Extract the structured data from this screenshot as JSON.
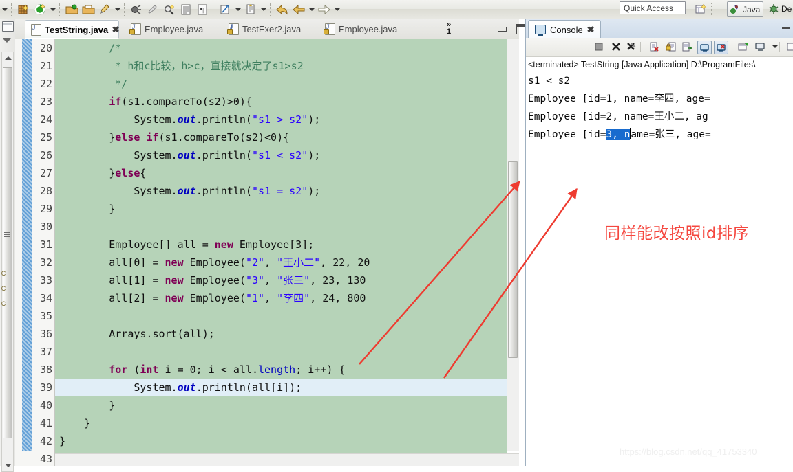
{
  "toolbar": {
    "quick_access_placeholder": "Quick Access",
    "perspective_java": "Java",
    "perspective_debug": "De",
    "icons": [
      "dropdown-arrow-icon",
      "new-wizard-icon",
      "run-icon",
      "run-dropdown-icon",
      "save-icon",
      "save-all-icon",
      "print-icon",
      "print-dropdown-icon",
      "debug-icon",
      "brush-icon",
      "search-icon",
      "outline-icon",
      "paragraph-icon",
      "external-tools-icon",
      "external-tools-dropdown-icon",
      "next-annotation-icon",
      "next-annotation-dropdown-icon",
      "back-icon",
      "back-yellow-icon",
      "back-dropdown-icon",
      "forward-icon",
      "forward-dropdown-icon"
    ]
  },
  "editor": {
    "tabs": [
      {
        "label": "TestString.java",
        "active": true,
        "closable": true,
        "locked": false
      },
      {
        "label": "Employee.java",
        "active": false,
        "closable": false,
        "locked": true
      },
      {
        "label": "TestExer2.java",
        "active": false,
        "closable": false,
        "locked": true
      },
      {
        "label": "Employee.java",
        "active": false,
        "closable": false,
        "locked": true
      }
    ],
    "overflow_chevron": "»",
    "overflow_count": "1",
    "minimize_label": "Minimize",
    "maximize_label": "Maximize",
    "first_line_number": 20,
    "highlighted_line": 39,
    "lines": [
      {
        "n": 20,
        "text": "        /*"
      },
      {
        "n": 21,
        "text": "         * h和c比较，h>c，直接就决定了s1>s2"
      },
      {
        "n": 22,
        "text": "         */"
      },
      {
        "n": 23,
        "text": "        if(s1.compareTo(s2)>0){"
      },
      {
        "n": 24,
        "text": "            System.out.println(\"s1 > s2\");"
      },
      {
        "n": 25,
        "text": "        }else if(s1.compareTo(s2)<0){"
      },
      {
        "n": 26,
        "text": "            System.out.println(\"s1 < s2\");"
      },
      {
        "n": 27,
        "text": "        }else{"
      },
      {
        "n": 28,
        "text": "            System.out.println(\"s1 = s2\");"
      },
      {
        "n": 29,
        "text": "        }"
      },
      {
        "n": 30,
        "text": ""
      },
      {
        "n": 31,
        "text": "        Employee[] all = new Employee[3];"
      },
      {
        "n": 32,
        "text": "        all[0] = new Employee(\"2\", \"王小二\", 22, 20"
      },
      {
        "n": 33,
        "text": "        all[1] = new Employee(\"3\", \"张三\", 23, 130"
      },
      {
        "n": 34,
        "text": "        all[2] = new Employee(\"1\", \"李四\", 24, 800"
      },
      {
        "n": 35,
        "text": ""
      },
      {
        "n": 36,
        "text": "        Arrays.sort(all);"
      },
      {
        "n": 37,
        "text": ""
      },
      {
        "n": 38,
        "text": "        for (int i = 0; i < all.length; i++) {"
      },
      {
        "n": 39,
        "text": "            System.out.println(all[i]);"
      },
      {
        "n": 40,
        "text": "        }"
      },
      {
        "n": 41,
        "text": "    }"
      },
      {
        "n": 42,
        "text": "}"
      },
      {
        "n": 43,
        "text": ""
      }
    ]
  },
  "console": {
    "tab_label": "Console",
    "tab_close": "✕",
    "status_line": "<terminated> TestString [Java Application] D:\\ProgramFiles\\",
    "toolbar_icons": [
      "terminate-icon",
      "remove-launch-icon",
      "remove-all-launches-icon",
      "clear-console-icon",
      "scroll-lock-icon",
      "show-console-on-output-icon",
      "pin-console-icon",
      "display-selected-console-icon",
      "open-console-icon",
      "open-console-dropdown-icon",
      "new-console-view-icon"
    ],
    "output": [
      {
        "text": "s1 < s2"
      },
      {
        "text": "Employee [id=1, name=李四, age="
      },
      {
        "text": "Employee [id=2, name=王小二, ag"
      },
      {
        "pre": "Employee [id=",
        "selected": "3, n",
        "post": "ame=张三, age="
      }
    ]
  },
  "annotation": {
    "note_text": "同样能改按照id排序",
    "note_color": "#f5473f",
    "arrows": 2
  },
  "watermark": {
    "text": "https://blog.csdn.net/qq_41753340"
  }
}
